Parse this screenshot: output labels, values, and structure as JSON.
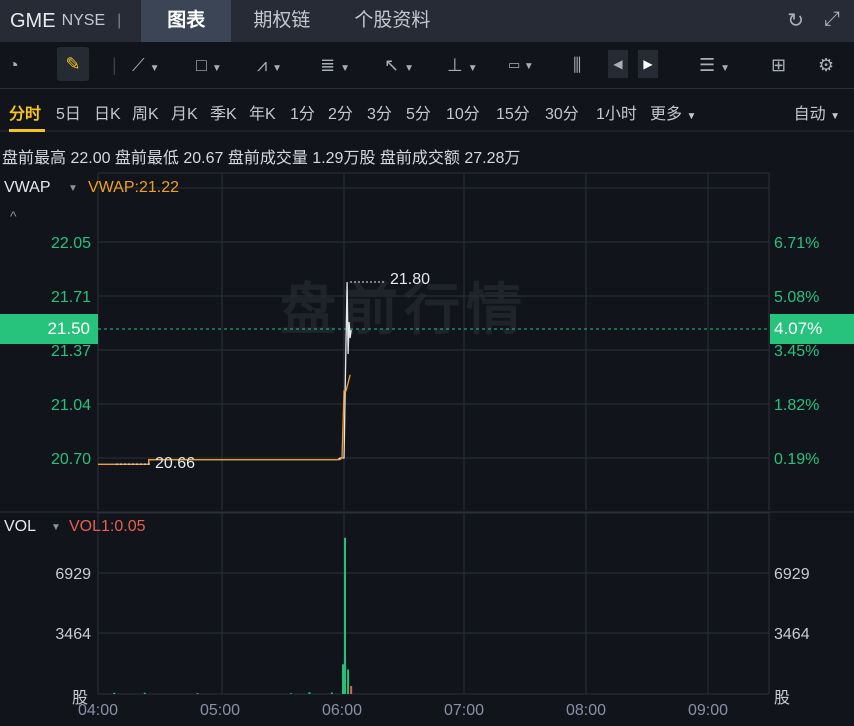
{
  "header": {
    "symbol": "GME",
    "exchange": "NYSE",
    "separator": "|",
    "tabs": [
      "图表",
      "期权链",
      "个股资料"
    ],
    "active_tab": 0
  },
  "toolbar_icons": [
    "speedometer-icon",
    "pencil-icon",
    "line-tool-icon",
    "rectangle-tool-icon",
    "pattern-tool-icon",
    "fib-tool-icon",
    "arrow-tool-icon",
    "measure-tool-icon",
    "text-tool-icon",
    "candle-indicator-icon",
    "prev-icon",
    "next-icon",
    "layout-list-icon",
    "grid-icon",
    "settings-icon"
  ],
  "periods": [
    "分时",
    "5日",
    "日K",
    "周K",
    "月K",
    "季K",
    "年K",
    "1分",
    "2分",
    "3分",
    "5分",
    "10分",
    "15分",
    "30分",
    "1小时",
    "更多"
  ],
  "active_period": 0,
  "scale_mode": "自动",
  "info": "盘前最高 22.00 盘前最低 20.67 盘前成交量 1.29万股 盘前成交额 27.28万",
  "price_panel": {
    "indicator": "VWAP",
    "indicator_value": "VWAP:21.22",
    "watermark": "盘前行情",
    "current_price": "21.50",
    "current_pct": "4.07%",
    "high_label": "21.80",
    "low_label": "20.66"
  },
  "vol_panel": {
    "indicator": "VOL",
    "indicator_value": "VOL1:0.05",
    "unit": "股"
  },
  "colors": {
    "up": "#27c27c",
    "down": "#e4604f",
    "vwap": "#f0a020",
    "accent": "#f5c518"
  },
  "chart_data": [
    {
      "type": "line",
      "title": "GME 分时",
      "y_ticks": [
        "22.05",
        "21.71",
        "21.37",
        "21.04",
        "20.70"
      ],
      "pct_ticks": [
        "6.71%",
        "5.08%",
        "3.45%",
        "1.82%",
        "0.19%"
      ],
      "ylim": [
        20.7,
        22.05
      ],
      "x_ticks": [
        "04:00",
        "05:00",
        "06:00",
        "07:00",
        "08:00",
        "09:00"
      ],
      "series": [
        {
          "name": "price",
          "points": [
            [
              0,
              20.66
            ],
            [
              25,
              20.66
            ],
            [
              25,
              20.69
            ],
            [
              118,
              20.69
            ],
            [
              119,
              20.7
            ],
            [
              121,
              20.7
            ],
            [
              122,
              21.45
            ],
            [
              122.5,
              21.8
            ],
            [
              123,
              21.35
            ],
            [
              123.5,
              21.55
            ],
            [
              124,
              21.45
            ],
            [
              124.5,
              21.5
            ]
          ]
        },
        {
          "name": "VWAP",
          "points": [
            [
              0,
              20.66
            ],
            [
              25,
              20.66
            ],
            [
              25,
              20.69
            ],
            [
              119,
              20.69
            ],
            [
              120,
              20.7
            ],
            [
              121,
              21.12
            ],
            [
              122,
              21.12
            ],
            [
              124,
              21.22
            ]
          ]
        }
      ]
    },
    {
      "type": "bar",
      "title": "VOL",
      "y_ticks": [
        "6929",
        "3464"
      ],
      "ylim": [
        0,
        10394
      ],
      "x_unit": "minutes since 04:00",
      "bars": [
        [
          8,
          70,
          "up"
        ],
        [
          23,
          70,
          "up"
        ],
        [
          49,
          50,
          "down"
        ],
        [
          95,
          40,
          "up"
        ],
        [
          104,
          100,
          "up"
        ],
        [
          115,
          80,
          "up"
        ],
        [
          120.5,
          1700,
          "up"
        ],
        [
          121.5,
          8950,
          "up"
        ],
        [
          123,
          1400,
          "up"
        ],
        [
          124.5,
          460,
          "down"
        ]
      ]
    }
  ]
}
